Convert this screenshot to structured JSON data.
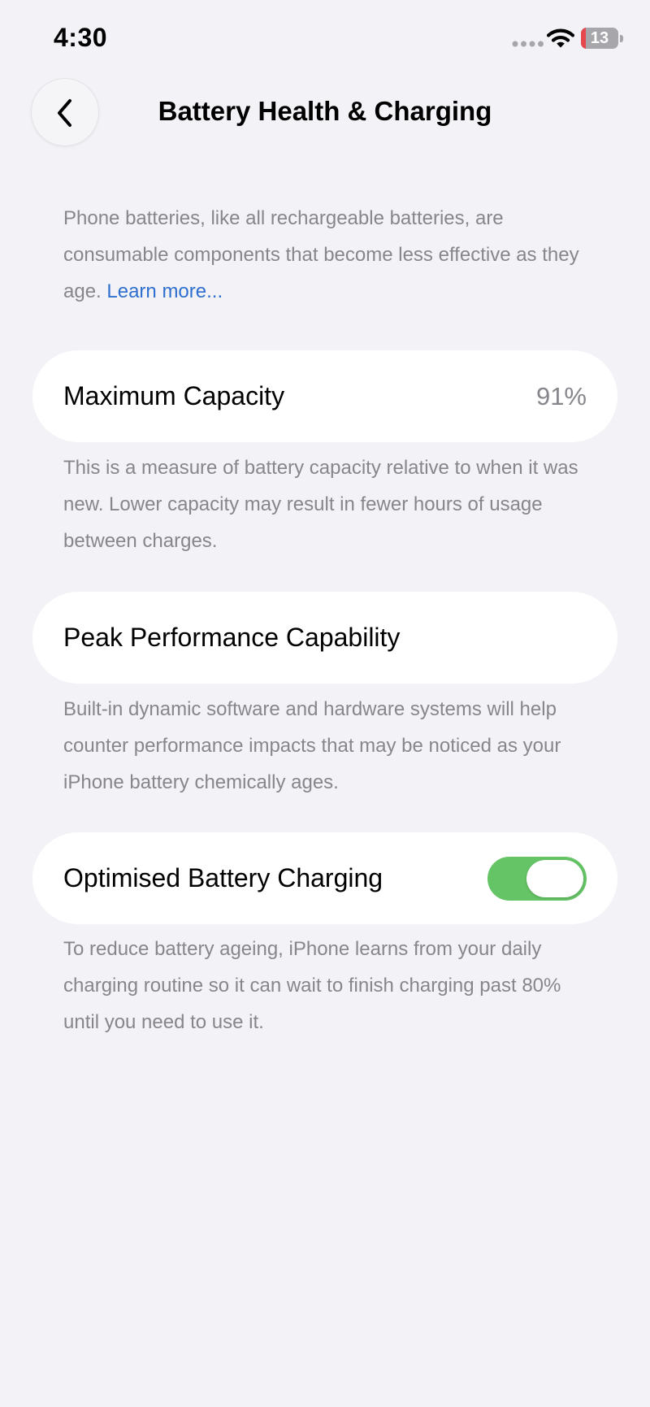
{
  "status_bar": {
    "time": "4:30",
    "battery_level": "13",
    "battery_fill_percent": 13,
    "icons": [
      "signal-dots-icon",
      "wifi-icon",
      "battery-icon"
    ]
  },
  "nav": {
    "title": "Battery Health & Charging",
    "back_icon": "chevron-left-icon"
  },
  "intro": {
    "text": "Phone batteries, like all rechargeable batteries, are consumable components that become less effective as they age. ",
    "link": "Learn more..."
  },
  "sections": {
    "capacity": {
      "label": "Maximum Capacity",
      "value": "91%",
      "footer": "This is a measure of battery capacity relative to when it was new. Lower capacity may result in fewer hours of usage between charges."
    },
    "performance": {
      "label": "Peak Performance Capability",
      "footer": "Built-in dynamic software and hardware systems will help counter performance impacts that may be noticed as your iPhone battery chemically ages."
    },
    "optimised": {
      "label": "Optimised Battery Charging",
      "toggle_on": true,
      "footer": "To reduce battery ageing, iPhone learns from your daily charging routine so it can wait to finish charging past 80% until you need to use it."
    }
  },
  "colors": {
    "background": "#f2f2f7",
    "card": "#ffffff",
    "secondary_text": "#86868b",
    "link": "#2f6fcf",
    "toggle_on": "#65c466",
    "battery_low": "#e5484d"
  }
}
